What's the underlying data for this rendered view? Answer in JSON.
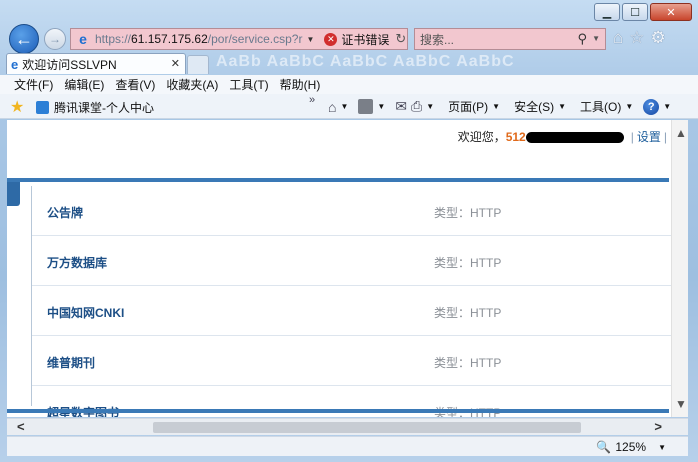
{
  "window": {
    "minimize": "▁",
    "maximize": "☐",
    "close": "✕"
  },
  "nav": {
    "url_prefix": "https://",
    "url_host": "61.157.175.62",
    "url_path": "/por/service.csp?r",
    "cert_label": "证书错误",
    "search_placeholder": "搜索..."
  },
  "tab": {
    "title": "欢迎访问SSLVPN"
  },
  "tab_watermark": "AaBb  AaBbC  AaBbC  AaBbC  AaBbC",
  "menu": [
    "文件(F)",
    "编辑(E)",
    "查看(V)",
    "收藏夹(A)",
    "工具(T)",
    "帮助(H)"
  ],
  "favorites": {
    "item": "腾讯课堂-个人中心"
  },
  "commands": {
    "page": "页面(P)",
    "safety": "安全(S)",
    "tools": "工具(O)"
  },
  "page": {
    "welcome": "欢迎您，",
    "user_prefix": "512",
    "settings": "设置",
    "services": [
      {
        "name": "公告牌",
        "type": "类型：HTTP"
      },
      {
        "name": "万方数据库",
        "type": "类型：HTTP"
      },
      {
        "name": "中国知网CNKI",
        "type": "类型：HTTP"
      },
      {
        "name": "维普期刊",
        "type": "类型：HTTP"
      },
      {
        "name": "超星数字图书",
        "type": "类型：HTTP"
      }
    ]
  },
  "status": {
    "zoom": "125%"
  },
  "icons": [
    "back-arrow-icon",
    "forward-arrow-icon",
    "ie-icon",
    "cert-error-icon",
    "refresh-icon",
    "search-icon",
    "home-icon",
    "star-icon",
    "gear-icon",
    "rss-icon",
    "print-icon",
    "help-icon",
    "zoom-icon"
  ]
}
